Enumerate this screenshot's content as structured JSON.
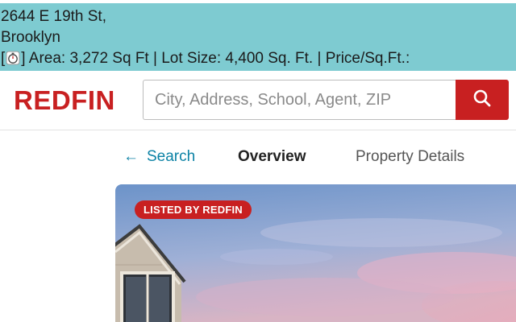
{
  "banner": {
    "address_line1": "2644 E 19th St,",
    "address_line2": "Brooklyn",
    "details_prefix": "[",
    "details_text": "] Area: 3,272 Sq Ft | Lot Size: 4,400 Sq. Ft. | Price/Sq.Ft.:",
    "icon": "stopwatch-icon"
  },
  "header": {
    "logo_text": "REDFIN",
    "search_placeholder": "City, Address, School, Agent, ZIP",
    "search_icon": "search-icon",
    "brand_color": "#c82021"
  },
  "nav": {
    "back_arrow": "←",
    "back_label": "Search",
    "tabs": [
      {
        "label": "Overview",
        "active": true
      },
      {
        "label": "Property Details",
        "active": false
      }
    ]
  },
  "photo": {
    "badge_label": "LISTED BY REDFIN"
  },
  "colors": {
    "banner_bg": "#7ecbd1",
    "link": "#0c82a5",
    "accent": "#c82021"
  }
}
